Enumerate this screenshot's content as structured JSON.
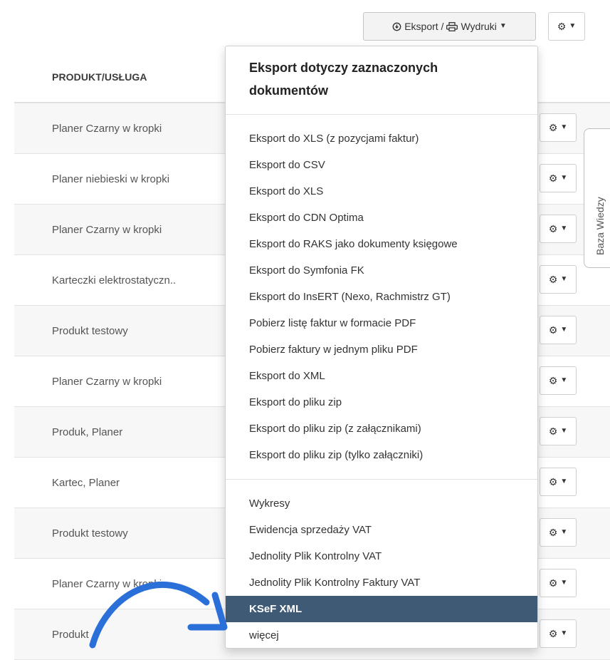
{
  "toolbar": {
    "export_label": "Eksport / ",
    "print_label": "Wydruki"
  },
  "table": {
    "header": "PRODUKT/USŁUGA",
    "rows": [
      "Planer Czarny w kropki",
      "Planer niebieski w kropki",
      "Planer Czarny w kropki",
      "Karteczki elektrostatyczn..",
      "Produkt testowy",
      "Planer Czarny w kropki",
      "Produk, Planer",
      "Kartec, Planer",
      "Produkt testowy",
      "Planer Czarny w kropki",
      "Produkt"
    ]
  },
  "dropdown": {
    "title": "Eksport dotyczy zaznaczonych dokumentów",
    "section1": [
      "Eksport do XLS (z pozycjami faktur)",
      "Eksport do CSV",
      "Eksport do XLS",
      "Eksport do CDN Optima",
      "Eksport do RAKS jako dokumenty księgowe",
      "Eksport do Symfonia FK",
      "Eksport do InsERT (Nexo, Rachmistrz GT)",
      "Pobierz listę faktur w formacie PDF",
      "Pobierz faktury w jednym pliku PDF",
      "Eksport do XML",
      "Eksport do pliku zip",
      "Eksport do pliku zip (z załącznikami)",
      "Eksport do pliku zip (tylko załączniki)"
    ],
    "section2": [
      "Wykresy",
      "Ewidencja sprzedaży VAT",
      "Jednolity Plik Kontrolny VAT",
      "Jednolity Plik Kontrolny Faktury VAT",
      "KSeF XML",
      "więcej"
    ],
    "active_item": "KSeF XML"
  },
  "side_tab": {
    "label": "Baza Wiedzy"
  },
  "colors": {
    "active_bg": "#3e5a75",
    "arrow": "#2b6fd8"
  },
  "icons": [
    "circle-down-icon",
    "printer-icon",
    "gear-icon",
    "caret-down-icon"
  ]
}
